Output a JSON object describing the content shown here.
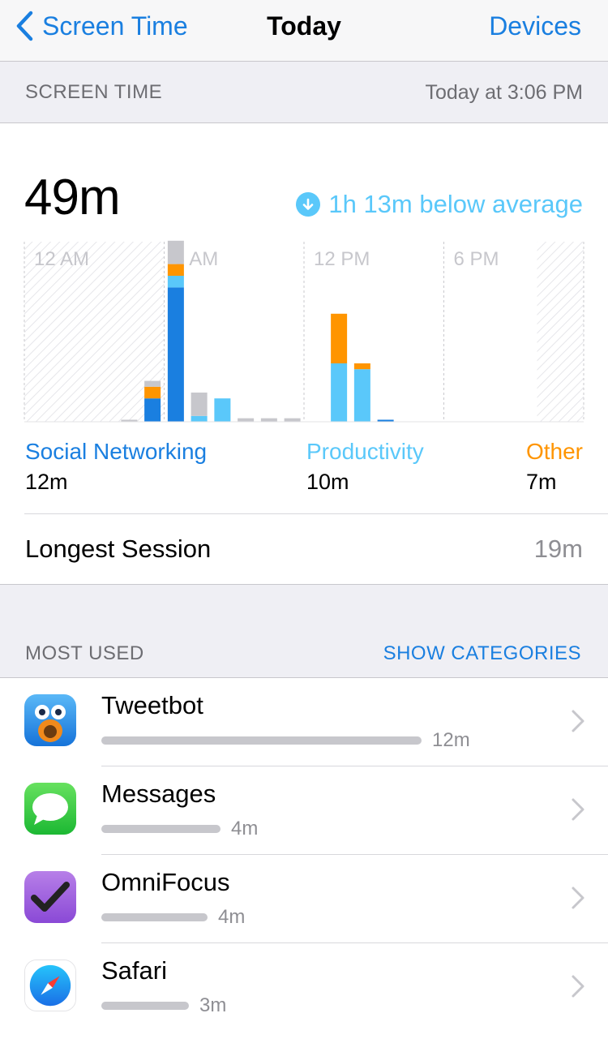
{
  "nav": {
    "back_label": "Screen Time",
    "title": "Today",
    "right_label": "Devices"
  },
  "screen_time_header": {
    "label": "SCREEN TIME",
    "timestamp": "Today at 3:06 PM"
  },
  "summary": {
    "total": "49m",
    "average_delta": "1h 13m below average"
  },
  "colors": {
    "accent": "#1a7fe0",
    "social": "#1a7fe0",
    "productivity": "#5ac8fa",
    "other": "#ff9500",
    "uncategorized": "#c7c7cc"
  },
  "chart_data": {
    "type": "bar",
    "stacked": true,
    "tick_labels": [
      "12 AM",
      "6 AM",
      "12 PM",
      "6 PM"
    ],
    "hours": [
      4,
      5,
      6,
      7,
      8,
      9,
      10,
      11,
      12,
      13,
      14,
      15,
      16
    ],
    "series": [
      {
        "name": "Social Networking",
        "color": "#1a7fe0",
        "values": [
          0,
          4,
          23,
          0,
          0,
          0,
          0,
          0,
          0,
          0,
          0,
          0.3,
          0
        ]
      },
      {
        "name": "Productivity",
        "color": "#5ac8fa",
        "values": [
          0,
          0,
          2,
          1,
          4,
          0,
          0,
          0,
          0,
          10,
          9,
          0,
          0
        ]
      },
      {
        "name": "Other",
        "color": "#ff9500",
        "values": [
          0,
          2,
          2,
          0,
          0,
          0,
          0,
          0,
          0,
          8.5,
          1,
          0,
          0
        ]
      },
      {
        "color": "#c7c7cc",
        "values": [
          0.3,
          1,
          4,
          4,
          0,
          0.6,
          0.6,
          0.6,
          0,
          0,
          0,
          0,
          0
        ]
      }
    ]
  },
  "categories": [
    {
      "name": "Social Networking",
      "value": "12m"
    },
    {
      "name": "Productivity",
      "value": "10m"
    },
    {
      "name": "Other",
      "value": "7m"
    }
  ],
  "longest_session": {
    "label": "Longest Session",
    "value": "19m"
  },
  "most_used_header": {
    "label": "MOST USED",
    "action": "SHOW CATEGORIES"
  },
  "apps": [
    {
      "name": "Tweetbot",
      "duration": "12m",
      "usage_fraction": 1.0,
      "icon": "tweetbot-icon"
    },
    {
      "name": "Messages",
      "duration": "4m",
      "usage_fraction": 0.37,
      "icon": "messages-icon"
    },
    {
      "name": "OmniFocus",
      "duration": "4m",
      "usage_fraction": 0.33,
      "icon": "omnifocus-icon"
    },
    {
      "name": "Safari",
      "duration": "3m",
      "usage_fraction": 0.27,
      "icon": "safari-icon"
    }
  ]
}
